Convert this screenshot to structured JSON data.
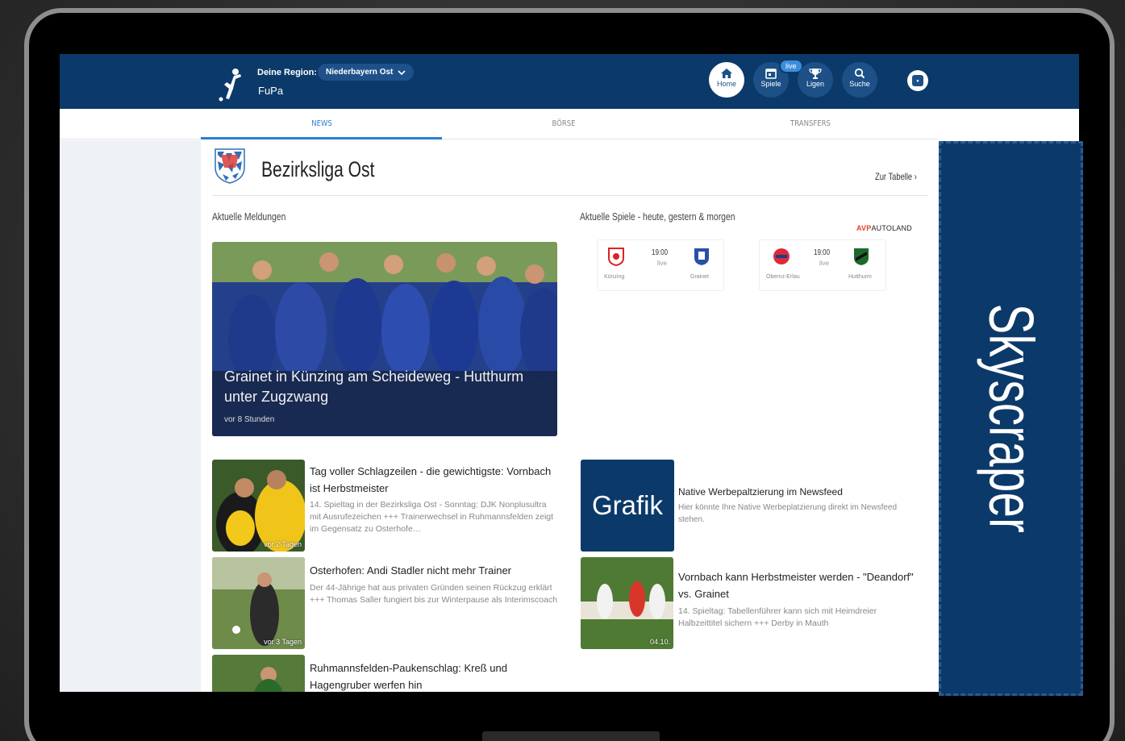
{
  "header": {
    "region_label": "Deine Region:",
    "region_value": "Niederbayern Ost",
    "brand": "FuPa",
    "nav": {
      "home": "Home",
      "spiele": "Spiele",
      "live": "live",
      "ligen": "Ligen",
      "suche": "Suche"
    },
    "colors": {
      "bar": "#0b3a6a",
      "accent": "#2a7fd4"
    }
  },
  "tabs": [
    "NEWS",
    "BÖRSE",
    "TRANSFERS"
  ],
  "league": {
    "title": "Bezirksliga Ost",
    "table_link": "Zur Tabelle ›"
  },
  "sections": {
    "news_head": "Aktuelle Meldungen",
    "matches_head": "Aktuelle Spiele - heute, gestern & morgen",
    "sponsor": "AUTOLAND"
  },
  "hero": {
    "title": "Grainet in Künzing am Scheideweg - Hutthurm unter Zugzwang",
    "time": "vor 8 Stunden"
  },
  "matches": [
    {
      "home": "Künzing",
      "away": "Grainet",
      "time": "19:00",
      "status": "live"
    },
    {
      "home": "Obernz-Erlau",
      "away": "Hutthurm",
      "time": "19:00",
      "status": "live"
    }
  ],
  "news": [
    {
      "title": "Tag voller Schlagzeilen - die gewichtigste: Vornbach ist Herbstmeister",
      "desc": "14. Spieltag in der Bezirksliga Ost - Sonntag: DJK Nonplusultra mit Ausrufezeichen +++ Trainerwechsel in Ruhmannsfelden zeigt im Gegensatz zu Osterhofe…",
      "time": "vor 2 Tagen"
    },
    {
      "title": "Osterhofen: Andi Stadler nicht mehr Trainer",
      "desc": "Der 44-Jährige hat aus privaten Gründen seinen Rückzug erklärt +++ Thomas Saller fungiert bis zur Winterpause als Interimscoach",
      "time": "vor 3 Tagen"
    },
    {
      "title": "Ruhmannsfelden-Paukenschlag: Kreß und Hagengruber werfen hin",
      "desc": "",
      "time": ""
    }
  ],
  "native_ad": {
    "box_label": "Grafik",
    "title": "Native Werbepaltzierung im Newsfeed",
    "desc": "Hier könnte Ihre Native Werbeplatzierung direkt im Newsfeed stehen."
  },
  "right_news": {
    "title": "Vornbach kann Herbstmeister werden - \"Deandorf\" vs. Grainet",
    "desc": "14. Spieltag: Tabellenführer kann sich mit Heimdreier Halbzeittitel sichern +++ Derby in Mauth",
    "time": "04.10."
  },
  "skyscraper": {
    "label": "Skyscraper"
  }
}
